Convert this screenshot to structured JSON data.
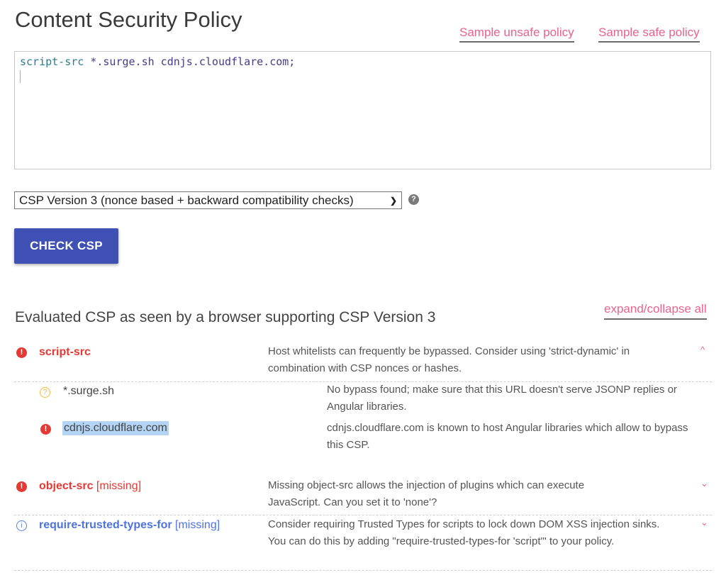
{
  "header": {
    "title": "Content Security Policy",
    "links": {
      "sample_unsafe": "Sample unsafe policy",
      "sample_safe": "Sample safe policy"
    }
  },
  "policy_input": {
    "directive": "script-src",
    "sources": "*.surge.sh cdnjs.cloudflare.com;"
  },
  "version_select": {
    "selected": "CSP Version 3 (nonce based + backward compatibility checks)",
    "help_icon": "?"
  },
  "check_button": {
    "label": "CHECK CSP"
  },
  "results": {
    "title": "Evaluated CSP as seen by a browser supporting CSP Version 3",
    "expand_collapse": "expand/collapse all",
    "colors": {
      "error": "#e53935",
      "warning": "#f5b942",
      "info": "#4f74e0",
      "accent": "#e8638e"
    },
    "items": [
      {
        "severity": "error",
        "directive": "script-src",
        "missing": "",
        "description": "Host whitelists can frequently be bypassed. Consider using 'strict-dynamic' in combination with CSP nonces or hashes.",
        "expanded": true,
        "chevron": "^",
        "sub_items": [
          {
            "severity": "warning",
            "value": "*.surge.sh",
            "description": "No bypass found; make sure that this URL doesn't serve JSONP replies or Angular libraries."
          },
          {
            "severity": "error",
            "value": "cdnjs.cloudflare.com",
            "description": "cdnjs.cloudflare.com is known to host Angular libraries which allow to bypass this CSP."
          }
        ]
      },
      {
        "severity": "error",
        "directive": "object-src",
        "missing": "[missing]",
        "description": "Missing object-src allows the injection of plugins which can execute JavaScript. Can you set it to 'none'?",
        "expanded": false,
        "chevron": "⌄"
      },
      {
        "severity": "info",
        "directive": "require-trusted-types-for",
        "missing": "[missing]",
        "description": "Consider requiring Trusted Types for scripts to lock down DOM XSS injection sinks. You can do this by adding \"require-trusted-types-for 'script'\" to your policy.",
        "expanded": false,
        "chevron": "⌄"
      }
    ]
  },
  "icons": {
    "error": "!",
    "warning": "?",
    "info": "i"
  }
}
